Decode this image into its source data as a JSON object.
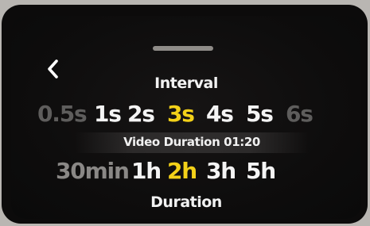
{
  "header": {
    "back_icon": "chevron-left-icon"
  },
  "interval": {
    "label": "Interval",
    "options": [
      "0.5s",
      "1s",
      "2s",
      "3s",
      "4s",
      "5s",
      "6s"
    ],
    "selected": "3s"
  },
  "video_duration": {
    "text": "Video Duration 01:20"
  },
  "duration": {
    "label": "Duration",
    "options": [
      "30min",
      "1h",
      "2h",
      "3h",
      "5h"
    ],
    "selected": "2h"
  },
  "colors": {
    "selected": "#f3d119",
    "text": "#f4f4f4",
    "background": "#0e0d0d"
  }
}
